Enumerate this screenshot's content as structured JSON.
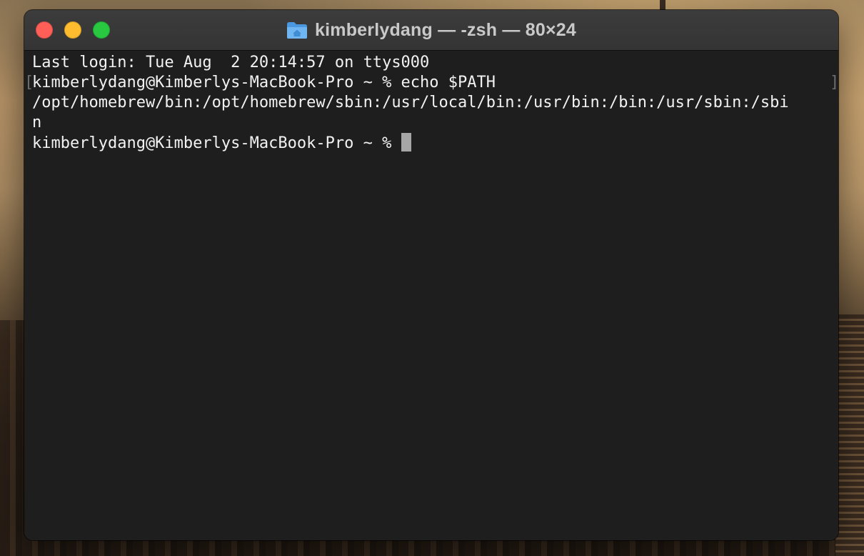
{
  "window": {
    "title": "kimberlydang — -zsh — 80×24"
  },
  "title_icon": "home-folder-icon",
  "traffic_lights": {
    "close": "close",
    "minimize": "minimize",
    "zoom": "zoom"
  },
  "terminal": {
    "lines": [
      "Last login: Tue Aug  2 20:14:57 on ttys000",
      "kimberlydang@Kimberlys-MacBook-Pro ~ % echo $PATH",
      "/opt/homebrew/bin:/opt/homebrew/sbin:/usr/local/bin:/usr/bin:/bin:/usr/sbin:/sbi",
      "n",
      "kimberlydang@Kimberlys-MacBook-Pro ~ % "
    ],
    "mark_open": "[",
    "mark_close": "]"
  },
  "colors": {
    "background": "#1e1e1e",
    "text": "#f2f2f2",
    "cursor": "#a6a6a6",
    "close": "#ff5f57",
    "minimize": "#febc2e",
    "zoom": "#28c840",
    "folder": "#5aa9ee"
  }
}
